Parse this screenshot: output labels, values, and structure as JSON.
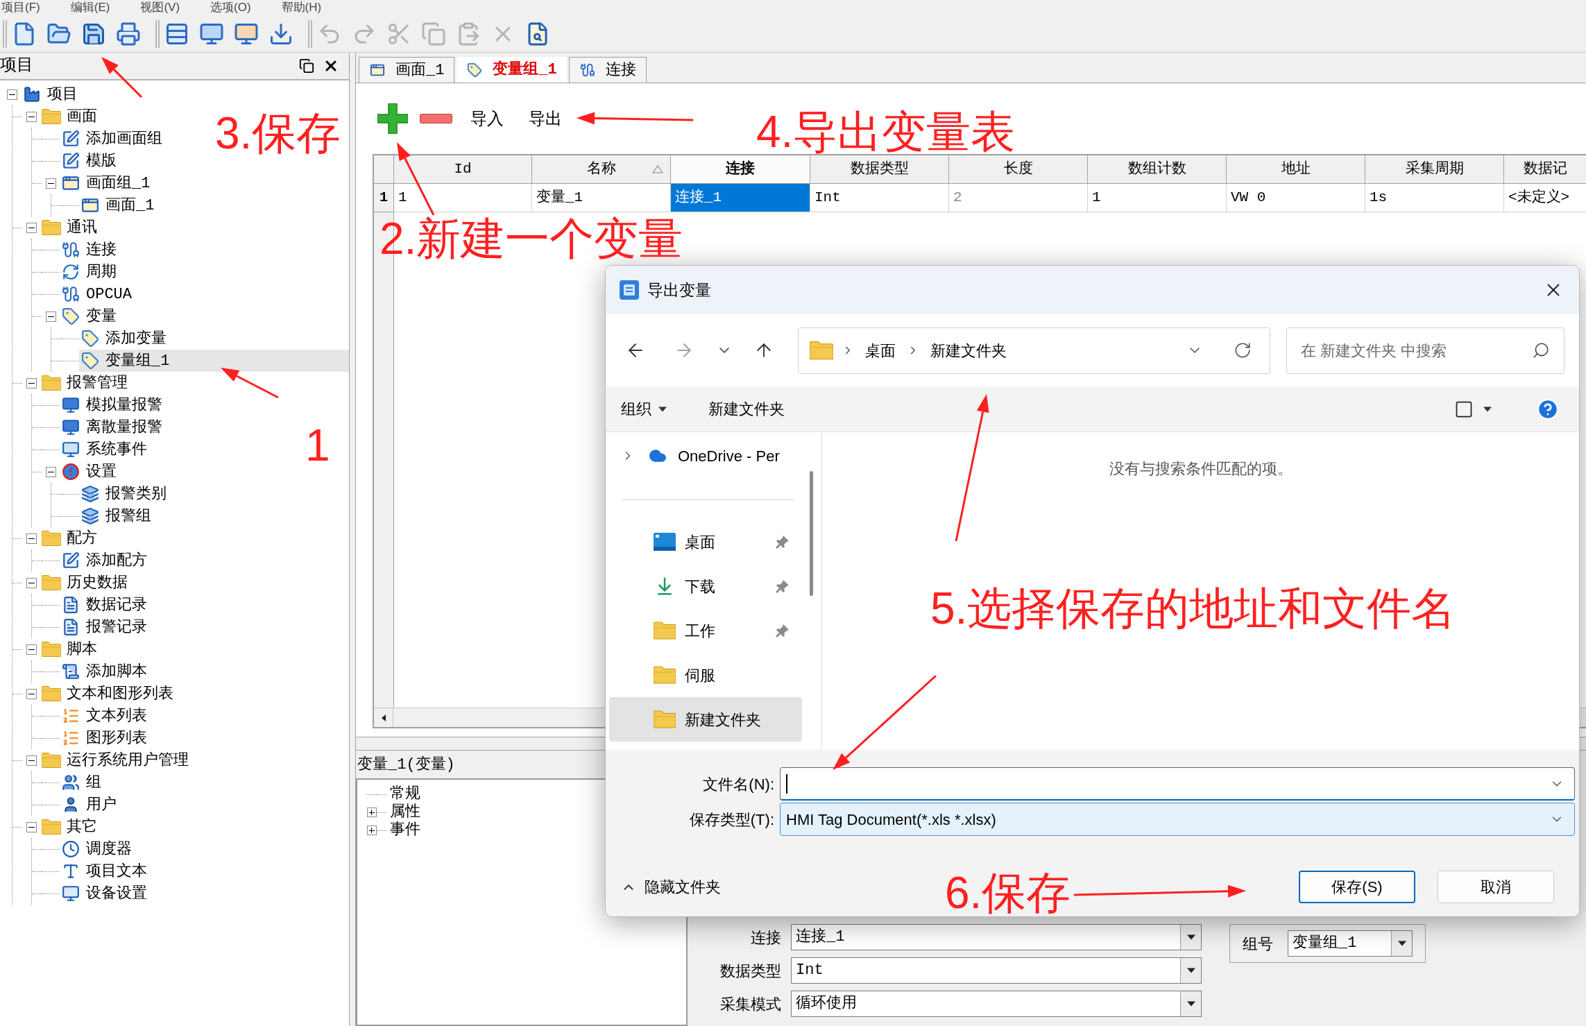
{
  "menu": [
    "项目(F)",
    "编辑(E)",
    "视图(V)",
    "选项(O)",
    "帮助(H)"
  ],
  "toolbar": {
    "groups": [
      [
        {
          "kind": "new",
          "disabled": false
        },
        {
          "kind": "open",
          "disabled": false
        },
        {
          "kind": "save",
          "disabled": false
        },
        {
          "kind": "print",
          "disabled": false
        }
      ],
      [
        {
          "kind": "tags",
          "disabled": false
        },
        {
          "kind": "screen",
          "disabled": false
        },
        {
          "kind": "transfer",
          "disabled": false
        },
        {
          "kind": "download",
          "disabled": false
        }
      ],
      [
        {
          "kind": "undo",
          "disabled": true
        },
        {
          "kind": "redo",
          "disabled": true
        },
        {
          "kind": "cut",
          "disabled": true
        },
        {
          "kind": "copy",
          "disabled": true
        },
        {
          "kind": "paste",
          "disabled": true
        },
        {
          "kind": "delete",
          "disabled": true
        },
        {
          "kind": "preview",
          "disabled": false
        }
      ]
    ]
  },
  "project_panel": {
    "title": "项目",
    "tree": [
      {
        "label": "项目",
        "kind": "project",
        "expanded": true,
        "selected": false,
        "children": [
          {
            "label": "画面",
            "kind": "folder",
            "expanded": true,
            "selected": false,
            "children": [
              {
                "label": "添加画面组",
                "kind": "add",
                "selected": false
              },
              {
                "label": "模版",
                "kind": "add",
                "selected": false
              },
              {
                "label": "画面组_1",
                "kind": "screen",
                "expanded": true,
                "selected": false,
                "children": [
                  {
                    "label": "画面_1",
                    "kind": "screen",
                    "selected": false
                  }
                ]
              }
            ]
          },
          {
            "label": "通讯",
            "kind": "folder",
            "expanded": true,
            "selected": false,
            "children": [
              {
                "label": "连接",
                "kind": "connection",
                "selected": false
              },
              {
                "label": "周期",
                "kind": "cycle",
                "selected": false
              },
              {
                "label": "OPCUA",
                "kind": "connection",
                "selected": false
              },
              {
                "label": "变量",
                "kind": "tag",
                "expanded": true,
                "selected": false,
                "children": [
                  {
                    "label": "添加变量",
                    "kind": "tag",
                    "selected": false
                  },
                  {
                    "label": "变量组_1",
                    "kind": "tag",
                    "selected": true
                  }
                ]
              }
            ]
          },
          {
            "label": "报警管理",
            "kind": "folder",
            "expanded": true,
            "selected": false,
            "children": [
              {
                "label": "模拟量报警",
                "kind": "alarm",
                "selected": false
              },
              {
                "label": "离散量报警",
                "kind": "alarm",
                "selected": false
              },
              {
                "label": "系统事件",
                "kind": "event",
                "selected": false
              },
              {
                "label": "设置",
                "kind": "settings",
                "expanded": true,
                "selected": false,
                "children": [
                  {
                    "label": "报警类别",
                    "kind": "alarmclass",
                    "selected": false
                  },
                  {
                    "label": "报警组",
                    "kind": "alarmclass",
                    "selected": false
                  }
                ]
              }
            ]
          },
          {
            "label": "配方",
            "kind": "folder",
            "expanded": true,
            "selected": false,
            "children": [
              {
                "label": "添加配方",
                "kind": "add",
                "selected": false
              }
            ]
          },
          {
            "label": "历史数据",
            "kind": "folder",
            "expanded": true,
            "selected": false,
            "children": [
              {
                "label": "数据记录",
                "kind": "log",
                "selected": false
              },
              {
                "label": "报警记录",
                "kind": "log",
                "selected": false
              }
            ]
          },
          {
            "label": "脚本",
            "kind": "folder",
            "expanded": true,
            "selected": false,
            "children": [
              {
                "label": "添加脚本",
                "kind": "script",
                "selected": false
              }
            ]
          },
          {
            "label": "文本和图形列表",
            "kind": "folder",
            "expanded": true,
            "selected": false,
            "children": [
              {
                "label": "文本列表",
                "kind": "list",
                "selected": false
              },
              {
                "label": "图形列表",
                "kind": "list",
                "selected": false
              }
            ]
          },
          {
            "label": "运行系统用户管理",
            "kind": "folder",
            "expanded": true,
            "selected": false,
            "children": [
              {
                "label": "组",
                "kind": "usergroup",
                "selected": false
              },
              {
                "label": "用户",
                "kind": "user",
                "selected": false
              }
            ]
          },
          {
            "label": "其它",
            "kind": "folder",
            "expanded": true,
            "selected": false,
            "children": [
              {
                "label": "调度器",
                "kind": "scheduler",
                "selected": false
              },
              {
                "label": "项目文本",
                "kind": "text",
                "selected": false
              },
              {
                "label": "设备设置",
                "kind": "device",
                "selected": false
              }
            ]
          }
        ]
      }
    ]
  },
  "tabs": [
    {
      "label": "画面_1",
      "kind": "screen",
      "selected": false
    },
    {
      "label": "变量组_1",
      "kind": "tag",
      "selected": true
    },
    {
      "label": "连接",
      "kind": "connection",
      "selected": false
    }
  ],
  "editor_toolbar": {
    "buttons": [
      {
        "label": "导入"
      },
      {
        "label": "导出"
      }
    ]
  },
  "table": {
    "columns": [
      {
        "label": "Id",
        "selected": false,
        "sorted": false
      },
      {
        "label": "名称",
        "selected": false,
        "sorted": true
      },
      {
        "label": "连接",
        "selected": true,
        "sorted": false
      },
      {
        "label": "数据类型",
        "selected": false,
        "sorted": false
      },
      {
        "label": "长度",
        "selected": false,
        "sorted": false
      },
      {
        "label": "数组计数",
        "selected": false,
        "sorted": false
      },
      {
        "label": "地址",
        "selected": false,
        "sorted": false
      },
      {
        "label": "采集周期",
        "selected": false,
        "sorted": false
      },
      {
        "label": "数据记",
        "selected": false,
        "sorted": false
      }
    ],
    "rows": [
      {
        "number": "1",
        "cells": [
          {
            "text": "1",
            "selected": false,
            "disabled": false
          },
          {
            "text": "变量_1",
            "selected": false,
            "disabled": false
          },
          {
            "text": "连接_1",
            "selected": true,
            "disabled": false
          },
          {
            "text": "Int",
            "selected": false,
            "disabled": false
          },
          {
            "text": "2",
            "selected": false,
            "disabled": true
          },
          {
            "text": "1",
            "selected": false,
            "disabled": false
          },
          {
            "text": "VW 0",
            "selected": false,
            "disabled": false
          },
          {
            "text": "1s",
            "selected": false,
            "disabled": false
          },
          {
            "text": "<未定义>",
            "selected": false,
            "disabled": false
          }
        ]
      }
    ]
  },
  "bottom_panel": {
    "title": "变量_1(变量)",
    "tree": [
      {
        "label": "常规",
        "selected": false
      },
      {
        "label": "属性",
        "expanded": false,
        "selected": false
      },
      {
        "label": "事件",
        "expanded": false,
        "selected": false
      }
    ]
  },
  "properties_form": {
    "fields": [
      {
        "label": "连接",
        "value": "连接_1"
      },
      {
        "label": "数据类型",
        "value": "Int"
      },
      {
        "label": "采集模式",
        "value": "循环使用"
      }
    ],
    "group": {
      "label": "组号",
      "value": "变量组_1"
    }
  },
  "dialog": {
    "title": "导出变量",
    "address": [
      "桌面",
      "新建文件夹"
    ],
    "search": {
      "placeholder": "在 新建文件夹 中搜索"
    },
    "commands": [
      {
        "label": "组织",
        "kind": "menu"
      },
      {
        "label": "新建文件夹",
        "kind": "button"
      }
    ],
    "nav_pane": {
      "locations": [
        {
          "label": "OneDrive - Per",
          "kind": "cloud",
          "expanded": false,
          "selected": false
        }
      ],
      "quick_access": [
        {
          "label": "桌面",
          "kind": "desktop",
          "pinned": true,
          "selected": false
        },
        {
          "label": "下载",
          "kind": "download",
          "pinned": true,
          "selected": false
        },
        {
          "label": "工作",
          "kind": "folder",
          "pinned": true,
          "selected": false
        },
        {
          "label": "伺服",
          "kind": "folder",
          "pinned": false,
          "selected": false
        },
        {
          "label": "新建文件夹",
          "kind": "folder",
          "pinned": false,
          "selected": true
        }
      ]
    },
    "empty_message": "没有与搜索条件匹配的项。",
    "file_name": {
      "label": "文件名(N):",
      "focused": true
    },
    "save_type": {
      "label": "保存类型(T):",
      "value": "HMI Tag Document(*.xls *.xlsx)"
    },
    "hide_folders": "隐藏文件夹",
    "buttons": [
      {
        "label": "保存(S)",
        "kind": "default"
      },
      {
        "label": "取消",
        "kind": "normal"
      }
    ]
  },
  "annotations": [
    {
      "text": "1"
    },
    {
      "text": "2.新建一个变量"
    },
    {
      "text": "3.保存"
    },
    {
      "text": "4.导出变量表"
    },
    {
      "text": "5.选择保存的地址和文件名"
    },
    {
      "text": "6.保存"
    }
  ]
}
